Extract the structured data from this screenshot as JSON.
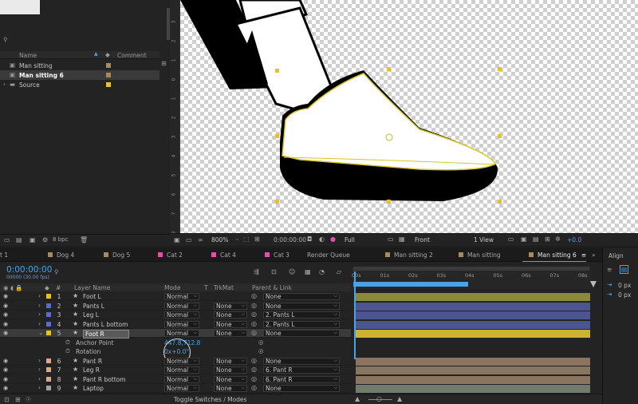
{
  "project": {
    "search_placeholder": "",
    "col_name": "Name",
    "col_comment": "Comment",
    "items": [
      {
        "label": "Man sitting",
        "color": "#a58b5d",
        "type": "comp"
      },
      {
        "label": "Man sitting 6",
        "color": "#a58b5d",
        "type": "comp",
        "selected": true
      },
      {
        "label": "Source",
        "color": "#e6c12c",
        "type": "folder"
      }
    ],
    "bpc": "8 bpc"
  },
  "ruler_numbers": [
    "3",
    "2",
    "1",
    "0",
    "1",
    "2",
    "3",
    "4",
    "5",
    "6",
    "7",
    "8"
  ],
  "viewer_bar": {
    "zoom": "800%",
    "timecode": "0:00:00:00",
    "resolution": "Full",
    "view": "Front",
    "views": "1 View",
    "exposure": "+0.0"
  },
  "tabs": [
    {
      "label": "t 1",
      "color": ""
    },
    {
      "label": "Dog 4",
      "color": "#a58b5d"
    },
    {
      "label": "Dog 5",
      "color": "#a58b5d"
    },
    {
      "label": "Cat 2",
      "color": "#e14fb0"
    },
    {
      "label": "Cat 4",
      "color": "#e14fb0"
    },
    {
      "label": "Cat 3",
      "color": "#e14fb0"
    },
    {
      "label": "Render Queue",
      "color": ""
    },
    {
      "label": "Man sitting 2",
      "color": "#a58b5d"
    },
    {
      "label": "Man sitting",
      "color": "#a58b5d"
    },
    {
      "label": "Man sitting 6",
      "color": "#a58b5d",
      "active": true
    }
  ],
  "timeline": {
    "timecode": "0:00:00:00",
    "timecode_sub": "00000 (30.00 fps)",
    "headers": {
      "num": "#",
      "layer_name": "Layer Name",
      "mode": "Mode",
      "t": "T",
      "trkmat": "TrkMat",
      "parent": "Parent & Link"
    },
    "ruler": [
      "00s",
      "01s",
      "02s",
      "03s",
      "04s",
      "05s",
      "06s",
      "07s",
      "08s"
    ],
    "layers": [
      {
        "num": "1",
        "name": "Foot L",
        "label": "#e6c12c",
        "mode": "Normal",
        "trkmat": "",
        "parent": "None",
        "bar": "#8b8a3a"
      },
      {
        "num": "2",
        "name": "Pants L",
        "label": "#5a6bd6",
        "mode": "Normal",
        "trkmat": "None",
        "parent": "None",
        "bar": "#4b5691"
      },
      {
        "num": "3",
        "name": "Leg L",
        "label": "#5a6bd6",
        "mode": "Normal",
        "trkmat": "None",
        "parent": "2. Pants L",
        "bar": "#4b5691"
      },
      {
        "num": "4",
        "name": "Pants L bottom",
        "label": "#5a6bd6",
        "mode": "Normal",
        "trkmat": "None",
        "parent": "2. Pants L",
        "bar": "#4b5691"
      },
      {
        "num": "5",
        "name": "Foot R",
        "label": "#e6c12c",
        "mode": "Normal",
        "trkmat": "None",
        "parent": "None",
        "bar": "#c9b32f",
        "selected": true
      }
    ],
    "sub_props": [
      {
        "name": "Anchor Point",
        "value": "447.8,712.8"
      },
      {
        "name": "Rotation",
        "value": "0x+0.0°"
      }
    ],
    "layers2": [
      {
        "num": "6",
        "name": "Pant R",
        "label": "#d9a98a",
        "mode": "Normal",
        "trkmat": "None",
        "parent": "None",
        "bar": "#8a7560"
      },
      {
        "num": "7",
        "name": "Leg R",
        "label": "#d9a98a",
        "mode": "Normal",
        "trkmat": "None",
        "parent": "6. Pant R",
        "bar": "#8a7560"
      },
      {
        "num": "8",
        "name": "Pant R bottom",
        "label": "#d9a98a",
        "mode": "Normal",
        "trkmat": "None",
        "parent": "6. Pant R",
        "bar": "#8a7560"
      },
      {
        "num": "9",
        "name": "Laptop",
        "label": "#9fa89a",
        "mode": "Normal",
        "trkmat": "None",
        "parent": "None",
        "bar": "#737a6e"
      }
    ],
    "footer": "Toggle Switches / Modes"
  },
  "align": {
    "title": "Align",
    "v1": "0 px",
    "v2": "0 px"
  }
}
